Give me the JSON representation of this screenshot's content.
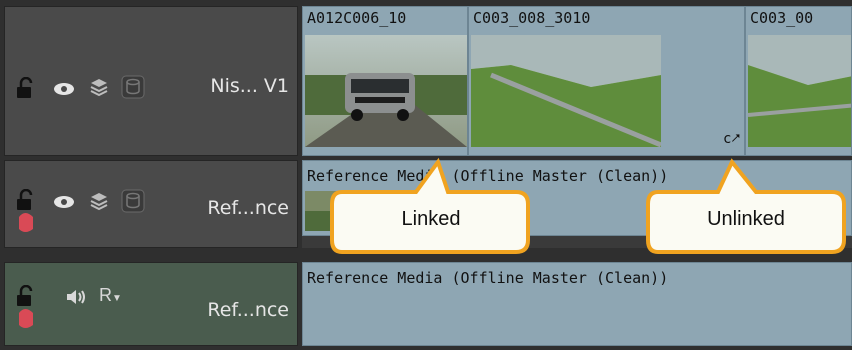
{
  "tracks": [
    {
      "name": "Nis... V1",
      "type": "video"
    },
    {
      "name": "Ref...nce",
      "type": "video"
    },
    {
      "name": "Ref...nce",
      "type": "audio",
      "channel_label": "R"
    }
  ],
  "clips_v1": [
    {
      "title": "A012C006_10"
    },
    {
      "title": "C003_008_3010"
    },
    {
      "title": "C003_00"
    }
  ],
  "reference_clip_title_v2": "Reference Media (Offline Master (Clean))",
  "reference_clip_title_a1": "Reference Media (Offline Master (Clean))",
  "callouts": {
    "linked": "Linked",
    "unlinked": "Unlinked"
  },
  "icons": {
    "lock": "lock-icon",
    "eye": "eye-icon",
    "layers": "layers-icon",
    "database": "database-icon",
    "speaker": "speaker-icon",
    "unlink": "unlink-icon"
  }
}
